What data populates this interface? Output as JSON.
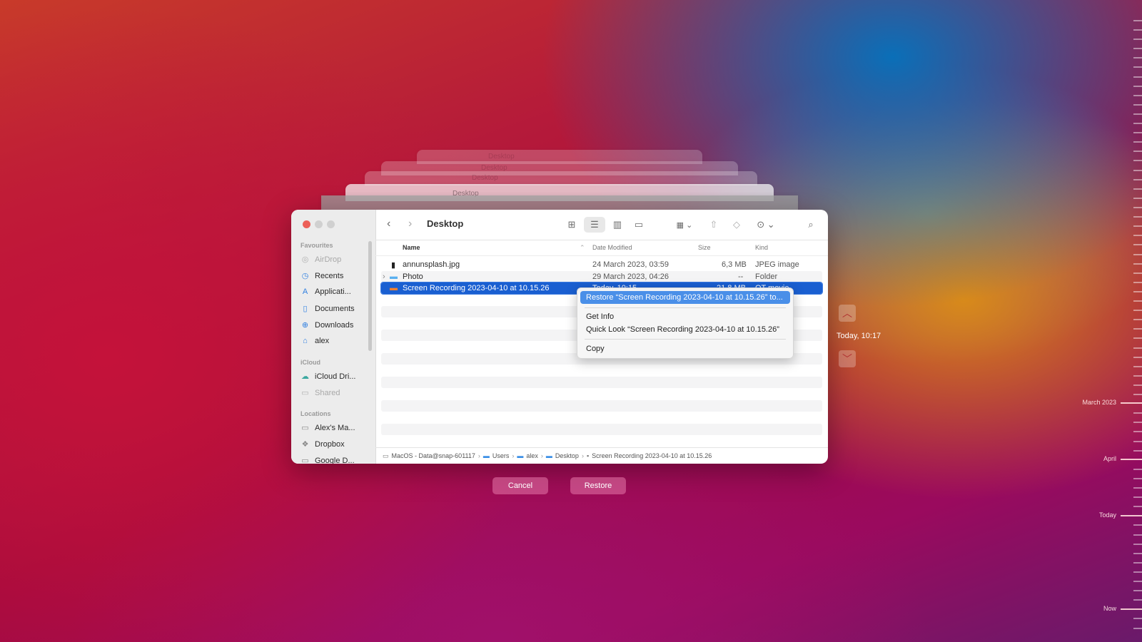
{
  "window": {
    "title": "Desktop",
    "back_icon": "chevron-left",
    "forward_icon": "chevron-right"
  },
  "ghost_windows": [
    {
      "title": "Desktop"
    },
    {
      "title": "Desktop"
    },
    {
      "title": "Desktop"
    },
    {
      "title": "Desktop"
    }
  ],
  "toolbar": {
    "view_icons": [
      "icon-view",
      "list-view",
      "column-view",
      "gallery-view"
    ],
    "active_view": "list-view",
    "group_icon": "group-by",
    "share_icon": "share",
    "tag_icon": "tag",
    "more_icon": "ellipsis-circle",
    "search_icon": "search"
  },
  "sidebar": {
    "sections": [
      {
        "label": "Favourites",
        "items": [
          {
            "label": "AirDrop",
            "icon": "airdrop",
            "dim": true
          },
          {
            "label": "Recents",
            "icon": "clock"
          },
          {
            "label": "Applicati...",
            "icon": "applications"
          },
          {
            "label": "Documents",
            "icon": "document"
          },
          {
            "label": "Downloads",
            "icon": "download"
          },
          {
            "label": "alex",
            "icon": "home"
          }
        ]
      },
      {
        "label": "iCloud",
        "items": [
          {
            "label": "iCloud Dri...",
            "icon": "cloud"
          },
          {
            "label": "Shared",
            "icon": "shared-folder",
            "dim": true
          }
        ]
      },
      {
        "label": "Locations",
        "items": [
          {
            "label": "Alex's Ma...",
            "icon": "disk"
          },
          {
            "label": "Dropbox",
            "icon": "dropbox"
          },
          {
            "label": "Google D...",
            "icon": "folder"
          }
        ]
      }
    ]
  },
  "columns": {
    "name": "Name",
    "date": "Date Modified",
    "size": "Size",
    "kind": "Kind"
  },
  "files": [
    {
      "name": "annunsplash.jpg",
      "date": "24 March 2023, 03:59",
      "size": "6,3 MB",
      "kind": "JPEG image",
      "icon": "image-file"
    },
    {
      "name": "Photo",
      "date": "29 March 2023, 04:26",
      "size": "--",
      "kind": "Folder",
      "icon": "folder",
      "expandable": true
    },
    {
      "name": "Screen Recording 2023-04-10 at 10.15.26",
      "date": "Today, 10:15",
      "size": "21,8 MB",
      "kind": "QT movie",
      "icon": "movie-file",
      "selected": true
    }
  ],
  "context_menu": {
    "items": [
      {
        "label": "Restore “Screen Recording 2023-04-10 at 10.15.26” to...",
        "highlighted": true
      },
      {
        "label": "Get Info"
      },
      {
        "label": "Quick Look “Screen Recording 2023-04-10 at 10.15.26”"
      },
      {
        "label": "Copy"
      }
    ]
  },
  "path_bar": [
    {
      "label": "MacOS - Data@snap-601117",
      "icon": "disk"
    },
    {
      "label": "Users",
      "icon": "folder"
    },
    {
      "label": "alex",
      "icon": "folder"
    },
    {
      "label": "Desktop",
      "icon": "folder"
    },
    {
      "label": "Screen Recording 2023-04-10 at 10.15.26",
      "icon": "movie-file"
    }
  ],
  "buttons": {
    "cancel": "Cancel",
    "restore": "Restore"
  },
  "time_machine": {
    "current_snapshot": "Today, 10:17",
    "up_icon": "chevron-up",
    "down_icon": "chevron-down",
    "timeline_labels": [
      "March 2023",
      "April",
      "Today",
      "Now"
    ]
  }
}
